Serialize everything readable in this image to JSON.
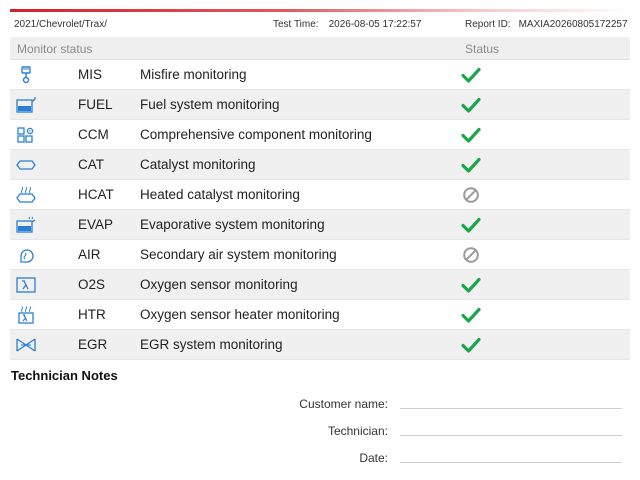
{
  "header": {
    "vehicle": "2021/Chevrolet/Trax/",
    "test_time_label": "Test Time:",
    "test_time_value": "2026-08-05 17:22:57",
    "report_id_label": "Report ID:",
    "report_id_value": "MAXIA20260805172257"
  },
  "table": {
    "columns": {
      "monitor": "Monitor status",
      "status": "Status"
    },
    "rows": [
      {
        "abbr": "MIS",
        "name": "Misfire monitoring",
        "icon": "piston-icon",
        "status": "ok"
      },
      {
        "abbr": "FUEL",
        "name": "Fuel system monitoring",
        "icon": "fuel-system-icon",
        "status": "ok"
      },
      {
        "abbr": "CCM",
        "name": "Comprehensive component monitoring",
        "icon": "components-icon",
        "status": "ok"
      },
      {
        "abbr": "CAT",
        "name": "Catalyst monitoring",
        "icon": "catalyst-icon",
        "status": "ok"
      },
      {
        "abbr": "HCAT",
        "name": "Heated catalyst monitoring",
        "icon": "heated-catalyst-icon",
        "status": "not-supported"
      },
      {
        "abbr": "EVAP",
        "name": "Evaporative system monitoring",
        "icon": "evap-icon",
        "status": "ok"
      },
      {
        "abbr": "AIR",
        "name": "Secondary air system monitoring",
        "icon": "secondary-air-icon",
        "status": "not-supported"
      },
      {
        "abbr": "O2S",
        "name": "Oxygen sensor monitoring",
        "icon": "oxygen-sensor-icon",
        "status": "ok"
      },
      {
        "abbr": "HTR",
        "name": "Oxygen sensor heater monitoring",
        "icon": "sensor-heater-icon",
        "status": "ok"
      },
      {
        "abbr": "EGR",
        "name": "EGR system monitoring",
        "icon": "egr-icon",
        "status": "ok"
      }
    ]
  },
  "notes": {
    "title": "Technician Notes",
    "customer_label": "Customer name:",
    "technician_label": "Technician:",
    "date_label": "Date:"
  },
  "colors": {
    "accent_red": "#d5202a",
    "icon_blue": "#2a7fd4",
    "ok_green": "#1aa64a",
    "na_gray": "#9a9a9a"
  }
}
